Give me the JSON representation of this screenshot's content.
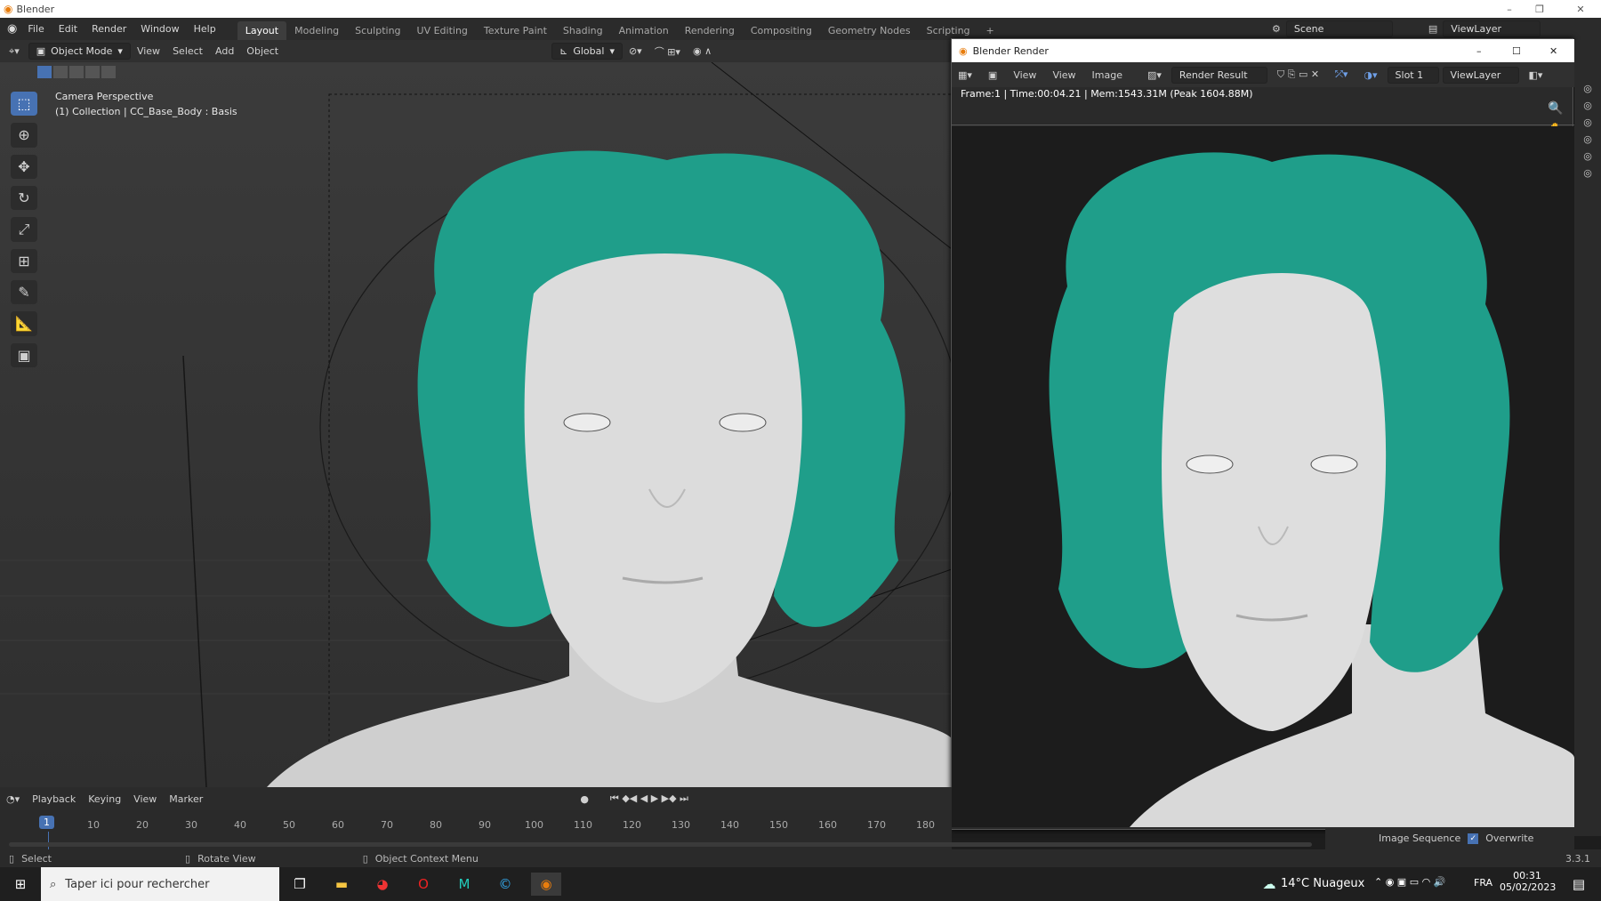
{
  "os_window": {
    "title": "Blender",
    "minimize": "–",
    "restore": "❐",
    "close": "✕"
  },
  "menu": {
    "items": [
      "File",
      "Edit",
      "Render",
      "Window",
      "Help"
    ]
  },
  "workspace_tabs": [
    {
      "label": "Layout",
      "active": true
    },
    {
      "label": "Modeling"
    },
    {
      "label": "Sculpting"
    },
    {
      "label": "UV Editing"
    },
    {
      "label": "Texture Paint"
    },
    {
      "label": "Shading"
    },
    {
      "label": "Animation"
    },
    {
      "label": "Rendering"
    },
    {
      "label": "Compositing"
    },
    {
      "label": "Geometry Nodes"
    },
    {
      "label": "Scripting"
    },
    {
      "label": "+"
    }
  ],
  "scene": {
    "name": "Scene",
    "view_layer": "ViewLayer"
  },
  "viewport_header": {
    "mode": "Object Mode",
    "menus": [
      "View",
      "Select",
      "Add",
      "Object"
    ],
    "orientation": "Global"
  },
  "viewport_overlay": {
    "line1": "Camera Perspective",
    "line2": "(1) Collection | CC_Base_Body : Basis"
  },
  "tools": [
    "select-box",
    "cursor",
    "move",
    "rotate",
    "scale",
    "transform",
    "annotate",
    "measure",
    "add-cube"
  ],
  "render_window": {
    "title": "Blender Render",
    "menus": [
      "View",
      "View",
      "Image"
    ],
    "result_name": "Render Result",
    "slot": "Slot 1",
    "view_layer": "ViewLayer",
    "info": "Frame:1 | Time:00:04.21 | Mem:1543.31M (Peak 1604.88M)"
  },
  "timeline": {
    "menus": [
      "Playback",
      "Keying",
      "View",
      "Marker"
    ],
    "current_frame": "1",
    "ticks": [
      "10",
      "20",
      "30",
      "40",
      "50",
      "60",
      "70",
      "80",
      "90",
      "100",
      "110",
      "120",
      "130",
      "140",
      "150",
      "160",
      "170",
      "180"
    ]
  },
  "output_panel": {
    "image_sequence": "Image Sequence",
    "overwrite": "Overwrite",
    "version": "3.3.1"
  },
  "status_bar": {
    "select": "Select",
    "rotate": "Rotate View",
    "context": "Object Context Menu"
  },
  "taskbar": {
    "search_placeholder": "Taper ici pour rechercher",
    "weather": "14°C  Nuageux",
    "lang": "FRA",
    "time": "00:31",
    "date": "05/02/2023"
  },
  "colors": {
    "hair": "#1f9e8a",
    "skin": "#dcdcdc",
    "accent": "#4772b3"
  }
}
